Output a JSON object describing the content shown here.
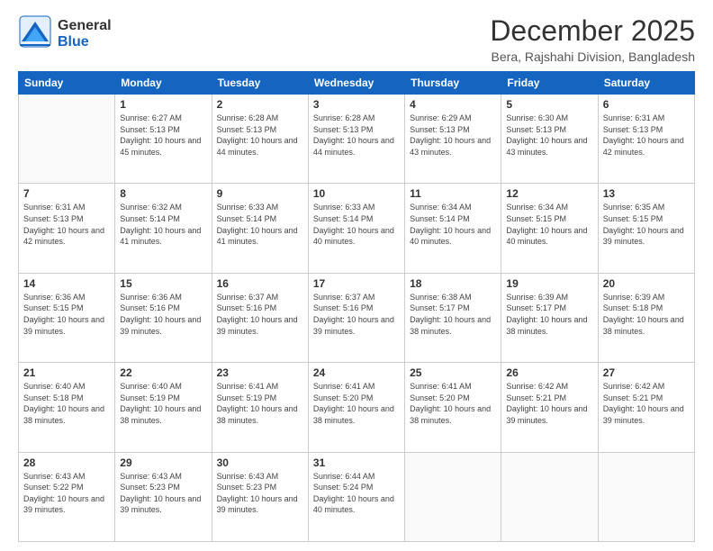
{
  "header": {
    "logo_general": "General",
    "logo_blue": "Blue",
    "title": "December 2025",
    "subtitle": "Bera, Rajshahi Division, Bangladesh"
  },
  "weekdays": [
    "Sunday",
    "Monday",
    "Tuesday",
    "Wednesday",
    "Thursday",
    "Friday",
    "Saturday"
  ],
  "weeks": [
    [
      {
        "day": "",
        "sunrise": "",
        "sunset": "",
        "daylight": ""
      },
      {
        "day": "1",
        "sunrise": "Sunrise: 6:27 AM",
        "sunset": "Sunset: 5:13 PM",
        "daylight": "Daylight: 10 hours and 45 minutes."
      },
      {
        "day": "2",
        "sunrise": "Sunrise: 6:28 AM",
        "sunset": "Sunset: 5:13 PM",
        "daylight": "Daylight: 10 hours and 44 minutes."
      },
      {
        "day": "3",
        "sunrise": "Sunrise: 6:28 AM",
        "sunset": "Sunset: 5:13 PM",
        "daylight": "Daylight: 10 hours and 44 minutes."
      },
      {
        "day": "4",
        "sunrise": "Sunrise: 6:29 AM",
        "sunset": "Sunset: 5:13 PM",
        "daylight": "Daylight: 10 hours and 43 minutes."
      },
      {
        "day": "5",
        "sunrise": "Sunrise: 6:30 AM",
        "sunset": "Sunset: 5:13 PM",
        "daylight": "Daylight: 10 hours and 43 minutes."
      },
      {
        "day": "6",
        "sunrise": "Sunrise: 6:31 AM",
        "sunset": "Sunset: 5:13 PM",
        "daylight": "Daylight: 10 hours and 42 minutes."
      }
    ],
    [
      {
        "day": "7",
        "sunrise": "Sunrise: 6:31 AM",
        "sunset": "Sunset: 5:13 PM",
        "daylight": "Daylight: 10 hours and 42 minutes."
      },
      {
        "day": "8",
        "sunrise": "Sunrise: 6:32 AM",
        "sunset": "Sunset: 5:14 PM",
        "daylight": "Daylight: 10 hours and 41 minutes."
      },
      {
        "day": "9",
        "sunrise": "Sunrise: 6:33 AM",
        "sunset": "Sunset: 5:14 PM",
        "daylight": "Daylight: 10 hours and 41 minutes."
      },
      {
        "day": "10",
        "sunrise": "Sunrise: 6:33 AM",
        "sunset": "Sunset: 5:14 PM",
        "daylight": "Daylight: 10 hours and 40 minutes."
      },
      {
        "day": "11",
        "sunrise": "Sunrise: 6:34 AM",
        "sunset": "Sunset: 5:14 PM",
        "daylight": "Daylight: 10 hours and 40 minutes."
      },
      {
        "day": "12",
        "sunrise": "Sunrise: 6:34 AM",
        "sunset": "Sunset: 5:15 PM",
        "daylight": "Daylight: 10 hours and 40 minutes."
      },
      {
        "day": "13",
        "sunrise": "Sunrise: 6:35 AM",
        "sunset": "Sunset: 5:15 PM",
        "daylight": "Daylight: 10 hours and 39 minutes."
      }
    ],
    [
      {
        "day": "14",
        "sunrise": "Sunrise: 6:36 AM",
        "sunset": "Sunset: 5:15 PM",
        "daylight": "Daylight: 10 hours and 39 minutes."
      },
      {
        "day": "15",
        "sunrise": "Sunrise: 6:36 AM",
        "sunset": "Sunset: 5:16 PM",
        "daylight": "Daylight: 10 hours and 39 minutes."
      },
      {
        "day": "16",
        "sunrise": "Sunrise: 6:37 AM",
        "sunset": "Sunset: 5:16 PM",
        "daylight": "Daylight: 10 hours and 39 minutes."
      },
      {
        "day": "17",
        "sunrise": "Sunrise: 6:37 AM",
        "sunset": "Sunset: 5:16 PM",
        "daylight": "Daylight: 10 hours and 39 minutes."
      },
      {
        "day": "18",
        "sunrise": "Sunrise: 6:38 AM",
        "sunset": "Sunset: 5:17 PM",
        "daylight": "Daylight: 10 hours and 38 minutes."
      },
      {
        "day": "19",
        "sunrise": "Sunrise: 6:39 AM",
        "sunset": "Sunset: 5:17 PM",
        "daylight": "Daylight: 10 hours and 38 minutes."
      },
      {
        "day": "20",
        "sunrise": "Sunrise: 6:39 AM",
        "sunset": "Sunset: 5:18 PM",
        "daylight": "Daylight: 10 hours and 38 minutes."
      }
    ],
    [
      {
        "day": "21",
        "sunrise": "Sunrise: 6:40 AM",
        "sunset": "Sunset: 5:18 PM",
        "daylight": "Daylight: 10 hours and 38 minutes."
      },
      {
        "day": "22",
        "sunrise": "Sunrise: 6:40 AM",
        "sunset": "Sunset: 5:19 PM",
        "daylight": "Daylight: 10 hours and 38 minutes."
      },
      {
        "day": "23",
        "sunrise": "Sunrise: 6:41 AM",
        "sunset": "Sunset: 5:19 PM",
        "daylight": "Daylight: 10 hours and 38 minutes."
      },
      {
        "day": "24",
        "sunrise": "Sunrise: 6:41 AM",
        "sunset": "Sunset: 5:20 PM",
        "daylight": "Daylight: 10 hours and 38 minutes."
      },
      {
        "day": "25",
        "sunrise": "Sunrise: 6:41 AM",
        "sunset": "Sunset: 5:20 PM",
        "daylight": "Daylight: 10 hours and 38 minutes."
      },
      {
        "day": "26",
        "sunrise": "Sunrise: 6:42 AM",
        "sunset": "Sunset: 5:21 PM",
        "daylight": "Daylight: 10 hours and 39 minutes."
      },
      {
        "day": "27",
        "sunrise": "Sunrise: 6:42 AM",
        "sunset": "Sunset: 5:21 PM",
        "daylight": "Daylight: 10 hours and 39 minutes."
      }
    ],
    [
      {
        "day": "28",
        "sunrise": "Sunrise: 6:43 AM",
        "sunset": "Sunset: 5:22 PM",
        "daylight": "Daylight: 10 hours and 39 minutes."
      },
      {
        "day": "29",
        "sunrise": "Sunrise: 6:43 AM",
        "sunset": "Sunset: 5:23 PM",
        "daylight": "Daylight: 10 hours and 39 minutes."
      },
      {
        "day": "30",
        "sunrise": "Sunrise: 6:43 AM",
        "sunset": "Sunset: 5:23 PM",
        "daylight": "Daylight: 10 hours and 39 minutes."
      },
      {
        "day": "31",
        "sunrise": "Sunrise: 6:44 AM",
        "sunset": "Sunset: 5:24 PM",
        "daylight": "Daylight: 10 hours and 40 minutes."
      },
      {
        "day": "",
        "sunrise": "",
        "sunset": "",
        "daylight": ""
      },
      {
        "day": "",
        "sunrise": "",
        "sunset": "",
        "daylight": ""
      },
      {
        "day": "",
        "sunrise": "",
        "sunset": "",
        "daylight": ""
      }
    ]
  ]
}
